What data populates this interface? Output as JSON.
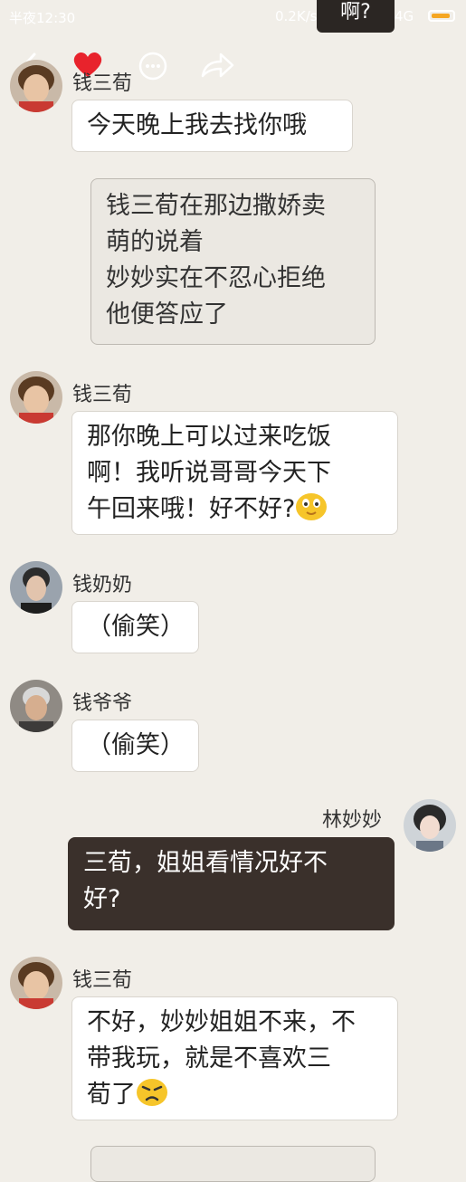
{
  "status_bar": {
    "time": "半夜12:30",
    "network_speed": "0.2K/s",
    "network_type": "4G",
    "tooltip": "啊?"
  },
  "messages": [
    {
      "speaker": "钱三荀",
      "text": "今天晚上我去找你哦"
    },
    {
      "narration": [
        "钱三荀在那边撒娇卖",
        "萌的说着",
        "妙妙实在不忍心拒绝",
        "他便答应了"
      ]
    },
    {
      "speaker": "钱三荀",
      "lines": [
        "那你晚上可以过来吃饭",
        "啊！我听说哥哥今天下",
        "午回来哦！好不好?"
      ]
    },
    {
      "speaker": "钱奶奶",
      "text": "（偷笑）"
    },
    {
      "speaker": "钱爷爷",
      "text": "（偷笑）"
    },
    {
      "speaker": "林妙妙",
      "lines": [
        "三荀，姐姐看情况好不",
        "好?"
      ]
    },
    {
      "speaker": "钱三荀",
      "lines": [
        "不好，妙妙姐姐不来，不",
        "带我玩，就是不喜欢三",
        "荀了"
      ]
    }
  ],
  "colors": {
    "background": "#f1eee8",
    "dark_bubble": "#3a302b",
    "heart": "#e8232c",
    "emoji": "#f6c52a"
  },
  "icons": [
    "back-icon",
    "heart-icon",
    "more-icon",
    "share-icon",
    "smile-emoji-icon",
    "sad-emoji-icon",
    "signal-icon",
    "battery-icon"
  ]
}
